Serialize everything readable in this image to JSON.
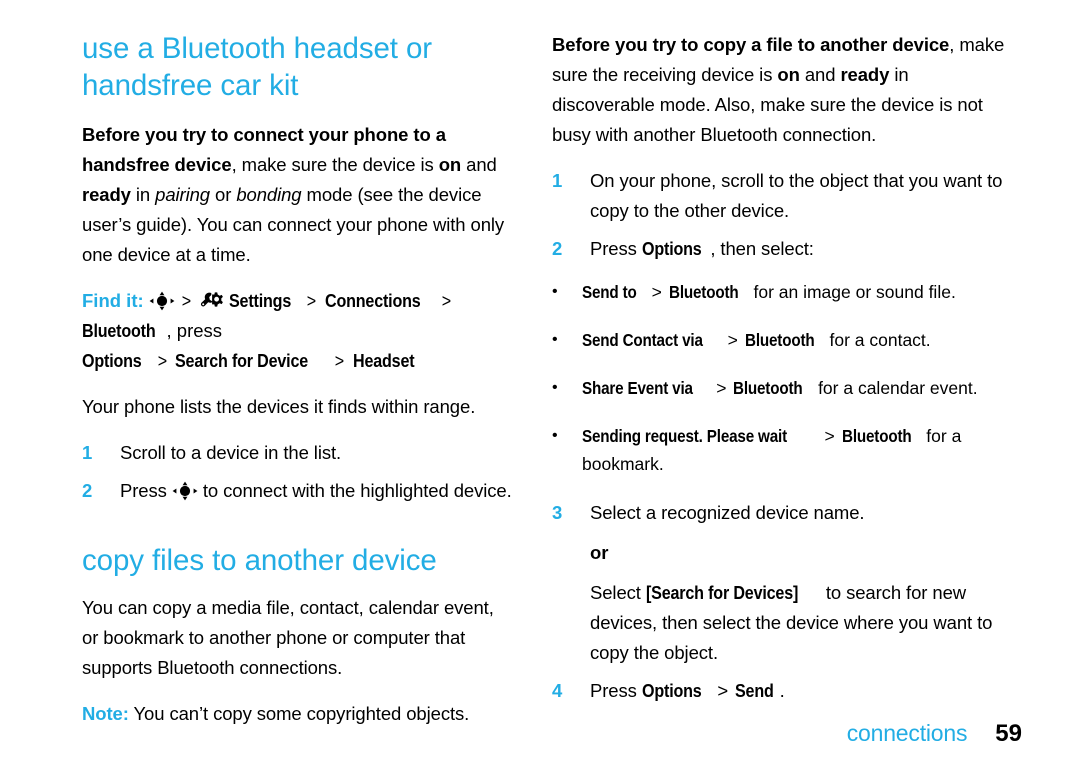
{
  "theme": {
    "accent": "#22ade4",
    "text": "#000000",
    "background": "#ffffff"
  },
  "left_column": {
    "heading": "use a Bluetooth headset or handsfree car kit",
    "intro": {
      "lead": "Before you try to connect your phone to a handsfree device",
      "part2": ", make sure the device is ",
      "on": "on",
      "and": " and ",
      "ready": "ready",
      "in": " in ",
      "pairing": "pairing",
      "or": " or ",
      "bonding": "bonding",
      "tail": " mode (see the device user’s guide). You can connect your phone with only one device at a time."
    },
    "find_it": {
      "label": "Find it:",
      "nav_icon": "navigation-key-icon",
      "sep": ">",
      "settings_icon": "settings-wrench-gear-icon",
      "settings": "Settings",
      "connections": "Connections",
      "bluetooth": "Bluetooth",
      "press": ", press",
      "options": "Options",
      "search_for_device": "Search for Device",
      "headset": "Headset"
    },
    "lists_intro": "Your phone lists the devices it finds within range.",
    "steps": [
      {
        "num": "1",
        "text": "Scroll to a device in the list."
      },
      {
        "num": "2",
        "text_before": "Press ",
        "icon": "navigation-key-icon",
        "text_after": " to connect with the highlighted device."
      }
    ],
    "heading2": "copy files to another device",
    "copy_paragraph": "You can copy a media file, contact, calendar event, or bookmark to another phone or computer that supports Bluetooth connections.",
    "note": {
      "label": "Note:",
      "text": " You can’t copy some copyrighted objects."
    }
  },
  "right_column": {
    "intro": {
      "lead": "Before you try to copy a file to another device",
      "part2": ", make sure the receiving device is ",
      "on": "on",
      "and": " and ",
      "ready": "ready",
      "tail": " in discoverable mode. Also, make sure the device is not busy with another Bluetooth connection."
    },
    "steps": [
      {
        "num": "1",
        "text": "On your phone, scroll to the object that you want to copy to the other device."
      },
      {
        "num": "2",
        "text_before": "Press ",
        "ui": "Options",
        "text_after": ", then select:"
      }
    ],
    "bullets": [
      {
        "marker": "•",
        "ui1": "Send to",
        "sep": ">",
        "ui2": "Bluetooth",
        "tail": " for an image or sound file."
      },
      {
        "marker": "•",
        "ui1": "Send Contact via",
        "sep": ">",
        "ui2": "Bluetooth",
        "tail": " for a contact."
      },
      {
        "marker": "•",
        "ui1": "Share Event via",
        "sep": ">",
        "ui2": "Bluetooth",
        "tail": " for a calendar event."
      },
      {
        "marker": "•",
        "ui1": "Sending request. Please wait",
        "sep": ">",
        "ui2": "Bluetooth",
        "tail": " for a bookmark."
      }
    ],
    "step3": {
      "num": "3",
      "text": "Select a recognized device name."
    },
    "or": "or",
    "step3_alt": {
      "before": "Select ",
      "ui": "[Search for Devices]",
      "after": " to search for new devices, then select the device where you want to copy the object."
    },
    "step4": {
      "num": "4",
      "before": "Press ",
      "ui1": "Options",
      "sep": ">",
      "ui2": "Send",
      "after": "."
    }
  },
  "footer": {
    "label": "connections",
    "page": "59"
  }
}
